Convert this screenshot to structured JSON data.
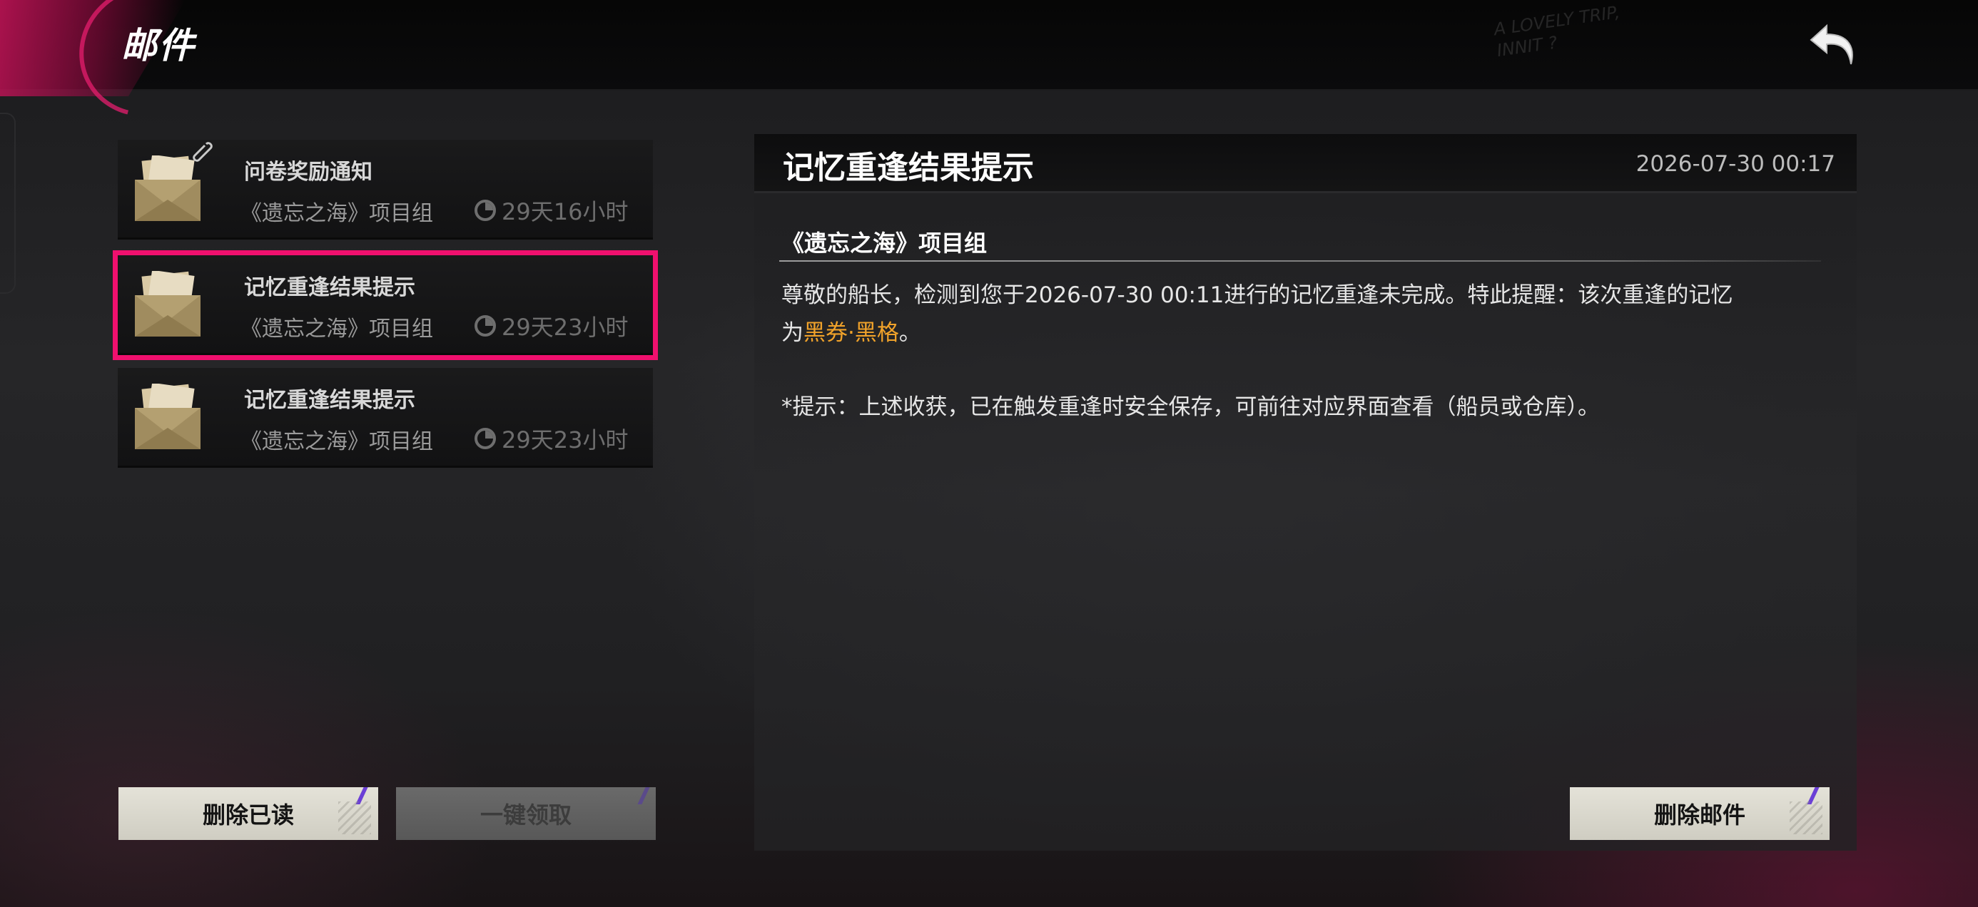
{
  "header": {
    "title": "邮件",
    "deco_line1": "A LOVELY TRIP,",
    "deco_line2": "INNIT ?"
  },
  "mail_list": [
    {
      "title": "问卷奖励通知",
      "sender": "《遗忘之海》项目组",
      "expiry": "29天16小时",
      "has_attachment": true,
      "selected": false
    },
    {
      "title": "记忆重逢结果提示",
      "sender": "《遗忘之海》项目组",
      "expiry": "29天23小时",
      "has_attachment": false,
      "selected": true
    },
    {
      "title": "记忆重逢结果提示",
      "sender": "《遗忘之海》项目组",
      "expiry": "29天23小时",
      "has_attachment": false,
      "selected": false
    }
  ],
  "buttons": {
    "delete_read": "删除已读",
    "claim_all": "一键领取",
    "delete_mail": "删除邮件"
  },
  "detail": {
    "title": "记忆重逢结果提示",
    "date": "2026-07-30 00:17",
    "sender": "《遗忘之海》项目组",
    "body_line1": "尊敬的船长，检测到您于2026-07-30 00:11进行的记忆重逢未完成。特此提醒：该次重逢的记忆",
    "body_line2_prefix": "为",
    "body_highlight": "黑券·黑格",
    "body_line2_suffix": "。",
    "note": "*提示：上述收获，已在触发重逢时安全保存，可前往对应界面查看（船员或仓库）。"
  },
  "colors": {
    "accent_pink": "#f0106e",
    "highlight_orange": "#f0a22a",
    "button_light": "#e4e2d8",
    "button_disabled": "#6a6a6a"
  },
  "icons": [
    "back-arrow-icon",
    "envelope-icon",
    "paperclip-icon",
    "clock-icon"
  ]
}
